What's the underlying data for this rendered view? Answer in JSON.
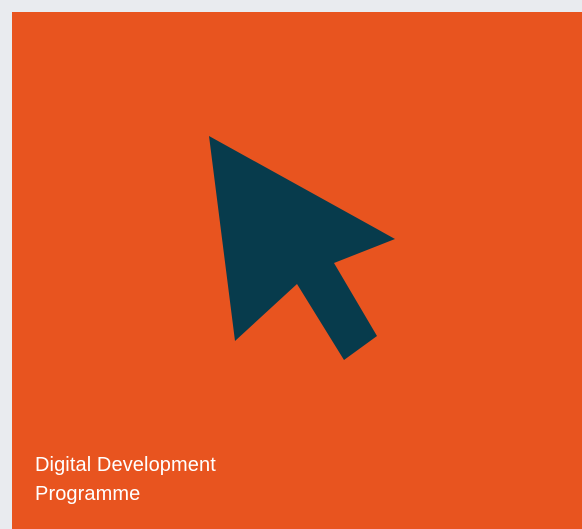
{
  "tile": {
    "title_line_1": "Digital Development",
    "title_line_2": "Programme",
    "icon": "cursor-arrow-icon",
    "background_color": "#e8541f",
    "icon_color": "#073b4c",
    "text_color": "#ffffff"
  },
  "page": {
    "background_color": "#e9ebef"
  }
}
